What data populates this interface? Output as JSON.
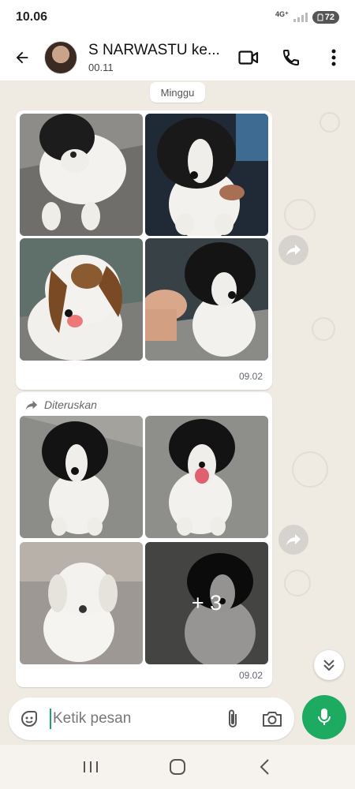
{
  "status_bar": {
    "time": "10.06",
    "network": "4G⁺",
    "battery": "72"
  },
  "header": {
    "contact_name": "S NARWASTU ke...",
    "subtitle": "00.11"
  },
  "chat": {
    "date_chip": "Minggu",
    "messages": [
      {
        "type": "photo-album",
        "forwarded": false,
        "time": "09.02",
        "photo_count": 4
      },
      {
        "type": "photo-album",
        "forwarded": true,
        "forwarded_label": "Diteruskan",
        "time": "09.02",
        "photo_count": 4,
        "more_count": "+ 3"
      }
    ]
  },
  "input": {
    "placeholder": "Ketik pesan"
  },
  "icons": {
    "back": "arrow-left-icon",
    "video": "video-call-icon",
    "phone": "phone-icon",
    "menu": "more-vert-icon",
    "forward": "forward-icon",
    "scroll": "double-chevron-down-icon",
    "sticker": "sticker-icon",
    "attach": "paperclip-icon",
    "camera": "camera-icon",
    "mic": "microphone-icon"
  },
  "colors": {
    "accent": "#1daa61",
    "chat_bg": "#efeae2",
    "bubble": "#ffffff"
  }
}
